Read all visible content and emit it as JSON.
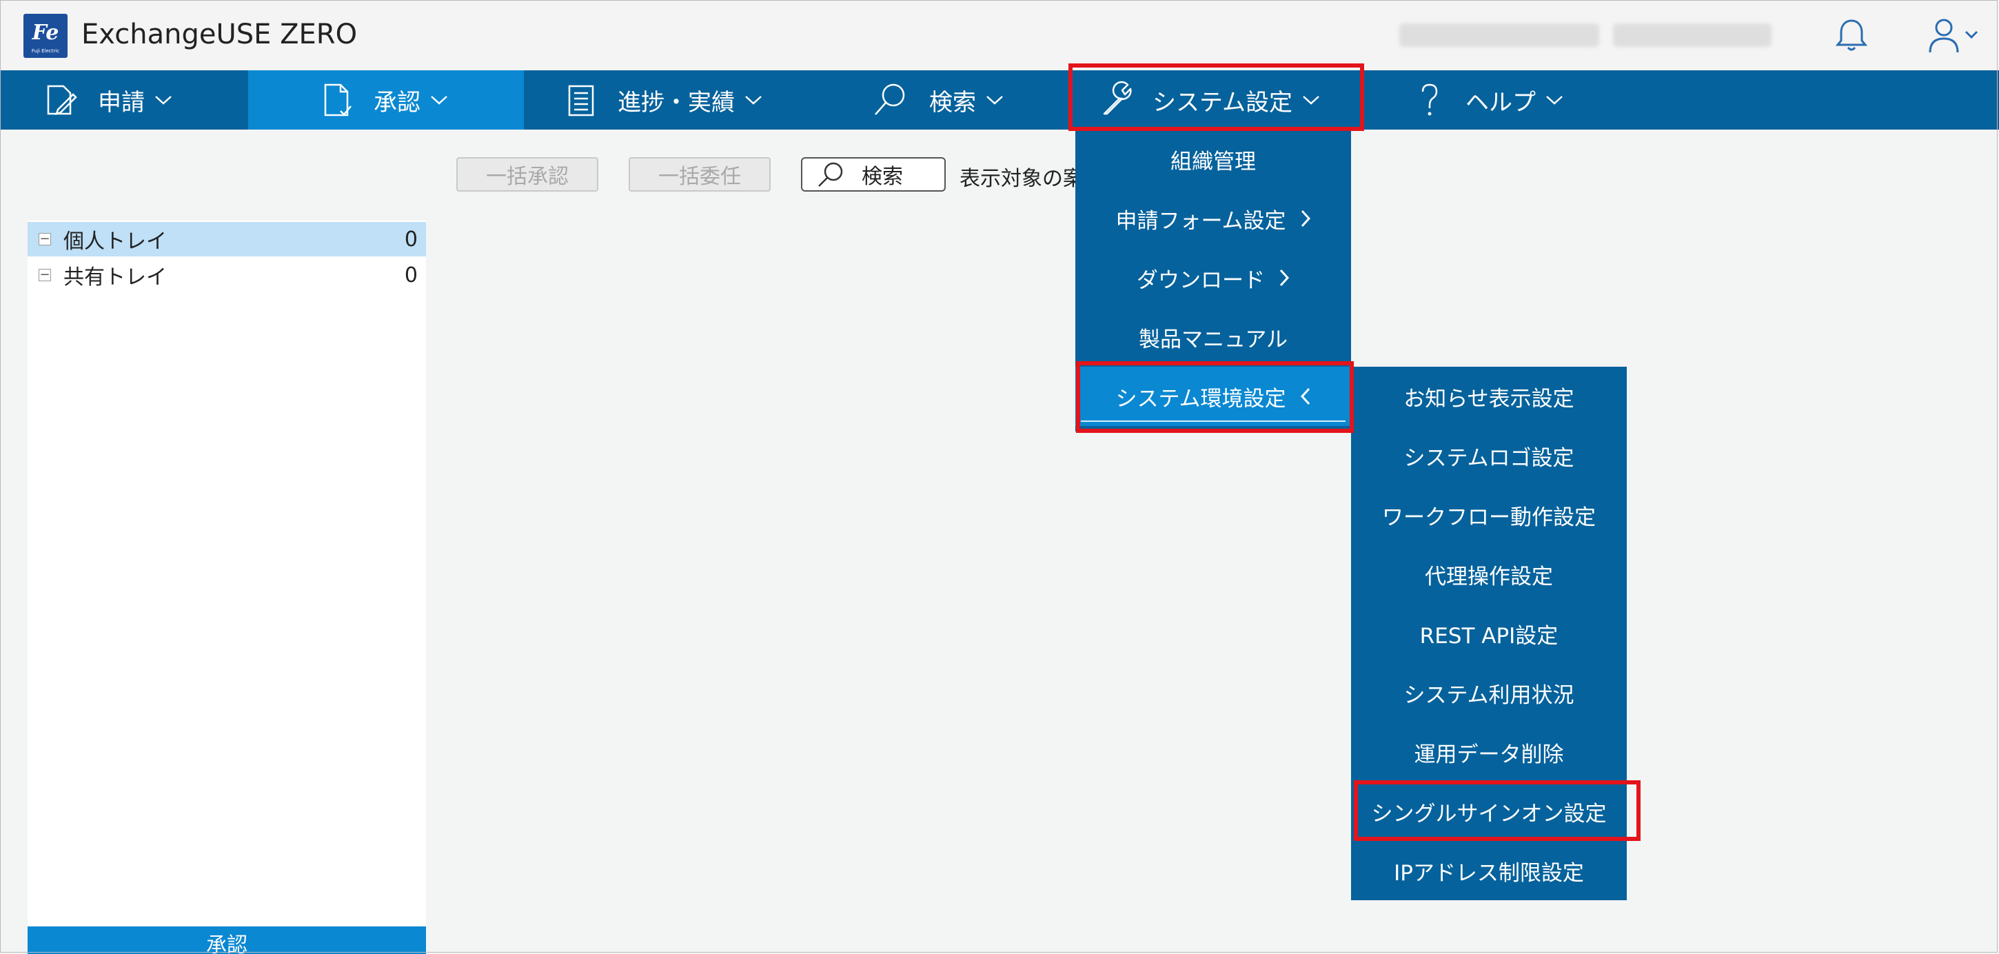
{
  "app": {
    "title": "ExchangeUSE ZERO",
    "logo_text": "Fe",
    "logo_sub": "Fuji Electric"
  },
  "nav": {
    "items": [
      {
        "label": "申請"
      },
      {
        "label": "承認"
      },
      {
        "label": "進捗・実績"
      },
      {
        "label": "検索"
      },
      {
        "label": "システム設定"
      },
      {
        "label": "ヘルプ"
      }
    ],
    "active_index": 1,
    "open_index": 4
  },
  "toolbar": {
    "bulk_approve": "一括承認",
    "bulk_delegate": "一括委任",
    "search": "検索",
    "display_target_label": "表示対象の案"
  },
  "trays": [
    {
      "label": "個人トレイ",
      "count": "0",
      "selected": true
    },
    {
      "label": "共有トレイ",
      "count": "0",
      "selected": false
    }
  ],
  "tray_footer": "承認",
  "system_menu": {
    "items": [
      {
        "label": "組織管理"
      },
      {
        "label": "申請フォーム設定"
      },
      {
        "label": "ダウンロード"
      },
      {
        "label": "製品マニュアル"
      },
      {
        "label": "システム環境設定"
      }
    ]
  },
  "env_submenu": {
    "items": [
      {
        "label": "お知らせ表示設定"
      },
      {
        "label": "システムロゴ設定"
      },
      {
        "label": "ワークフロー動作設定"
      },
      {
        "label": "代理操作設定"
      },
      {
        "label": "REST API設定"
      },
      {
        "label": "システム利用状況"
      },
      {
        "label": "運用データ削除"
      },
      {
        "label": "シングルサインオン設定"
      },
      {
        "label": "IPアドレス制限設定"
      }
    ]
  },
  "colors": {
    "nav_bg": "#06629c",
    "nav_active": "#0a88d2",
    "highlight": "#e3141b"
  },
  "icons": [
    "pencil-doc-icon",
    "doc-check-icon",
    "clipboard-icon",
    "search-icon",
    "wrench-icon",
    "help-icon",
    "bell-icon",
    "user-icon"
  ]
}
